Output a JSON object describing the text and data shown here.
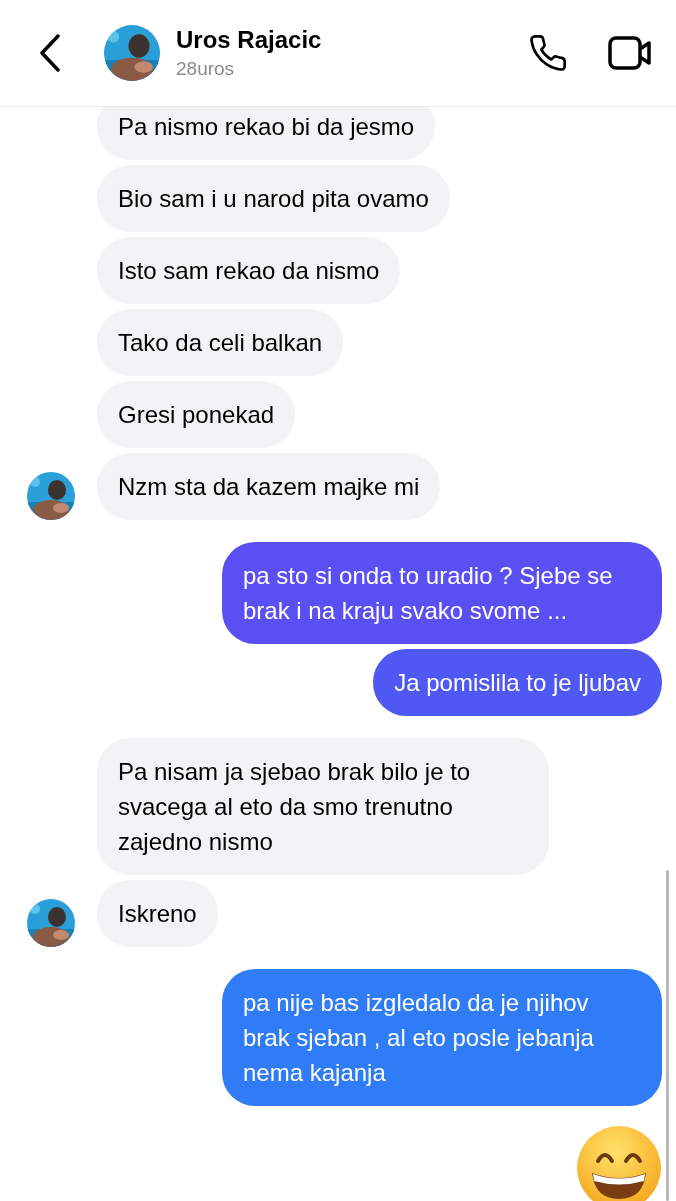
{
  "header": {
    "name": "Uros Rajacic",
    "username": "28uros"
  },
  "messages": [
    {
      "kind": "text",
      "outgoing": false,
      "text": "Pa nismo rekao bi da jesmo",
      "show_avatar": false
    },
    {
      "kind": "text",
      "outgoing": false,
      "text": "Bio sam i u narod pita ovamo",
      "show_avatar": false
    },
    {
      "kind": "text",
      "outgoing": false,
      "text": "Isto sam rekao da nismo",
      "show_avatar": false
    },
    {
      "kind": "text",
      "outgoing": false,
      "text": "Tako da celi balkan",
      "show_avatar": false
    },
    {
      "kind": "text",
      "outgoing": false,
      "text": "Gresi ponekad",
      "show_avatar": false
    },
    {
      "kind": "text",
      "outgoing": false,
      "text": "Nzm sta da kazem majke mi",
      "show_avatar": true
    },
    {
      "kind": "text",
      "outgoing": true,
      "text": "pa sto si onda to uradio ? Sjebe se brak i na kraju svako svome ...",
      "color": "#5a4ff2"
    },
    {
      "kind": "text",
      "outgoing": true,
      "text": "Ja pomislila to je ljubav",
      "color": "#4f58f2"
    },
    {
      "kind": "text",
      "outgoing": false,
      "text": "Pa nisam ja sjebao brak bilo je to svacega al eto da smo trenutno zajedno nismo",
      "show_avatar": false
    },
    {
      "kind": "text",
      "outgoing": false,
      "text": "Iskreno",
      "show_avatar": true
    },
    {
      "kind": "text",
      "outgoing": true,
      "text": "pa nije bas izgledalo da je njihov brak sjeban , al eto posle jebanja nema kajanja",
      "color": "#2f7cf6"
    },
    {
      "kind": "emoji",
      "outgoing": true
    }
  ]
}
